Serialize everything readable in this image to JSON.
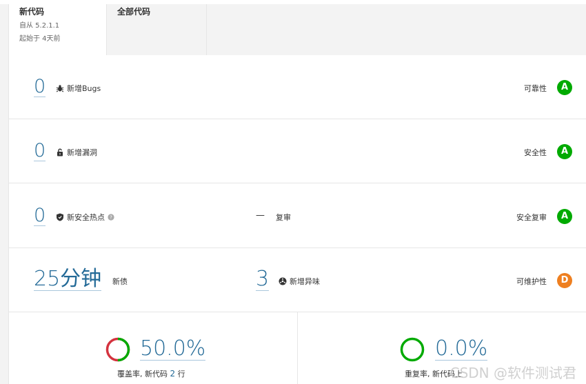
{
  "tabs": {
    "new_code": {
      "title": "新代码",
      "since": "自从 5.2.1.1",
      "started": "起始于 4天前"
    },
    "all_code": {
      "title": "全部代码"
    }
  },
  "rows": {
    "bugs": {
      "value": "0",
      "label": "新增Bugs",
      "rating_label": "可靠性",
      "rating": "A",
      "rating_color": "#00aa00",
      "icon": "bug-icon"
    },
    "vulns": {
      "value": "0",
      "label": "新增漏洞",
      "rating_label": "安全性",
      "rating": "A",
      "rating_color": "#00aa00",
      "icon": "lock-icon"
    },
    "hotspots": {
      "value": "0",
      "label": "新安全热点",
      "review_value": "—",
      "review_label": "复审",
      "rating_label": "安全复审",
      "rating": "A",
      "rating_color": "#00aa00",
      "icon": "shield-icon",
      "help_icon": "help-icon"
    },
    "maint": {
      "debt_value": "25分钟",
      "debt_label": "新债",
      "smells_value": "3",
      "smells_label": "新增异味",
      "rating_label": "可维护性",
      "rating": "D",
      "rating_color": "#ee7f20",
      "icon": "smell-icon"
    }
  },
  "coverage": {
    "value": "50.0%",
    "caption_prefix": "覆盖率, 新代码",
    "lines": "2",
    "caption_suffix": "行",
    "progress": 0.5,
    "covered_color": "#00aa00",
    "uncovered_color": "#d4333f"
  },
  "duplication": {
    "value": "0.0%",
    "caption": "重复率, 新代码上",
    "progress": 0.0,
    "color": "#00aa00"
  },
  "watermark": "CSDN @软件测试君"
}
